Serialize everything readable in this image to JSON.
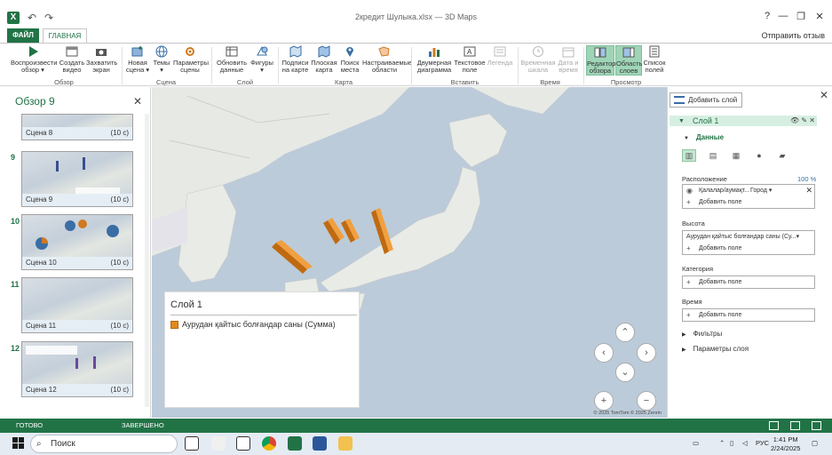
{
  "titlebar": {
    "app_icon": "X",
    "title": "2кредит Шулыка.xlsx — 3D Maps",
    "help": "?",
    "minimize": "—",
    "restore": "❐",
    "close": "✕"
  },
  "tabs": {
    "file": "ФАЙЛ",
    "home": "ГЛАВНАЯ",
    "signout": "Отправить отзыв"
  },
  "ribbon": {
    "buttons": [
      {
        "l1": "Воспроизвести",
        "l2": "обзор ▾"
      },
      {
        "l1": "Создать",
        "l2": "видео"
      },
      {
        "l1": "Захватить",
        "l2": "экран"
      },
      {
        "l1": "Новая",
        "l2": "сцена ▾"
      },
      {
        "l1": "Темы",
        "l2": "▾"
      },
      {
        "l1": "Параметры",
        "l2": "сцены"
      },
      {
        "l1": "Обновить",
        "l2": "данные"
      },
      {
        "l1": "Фигуры",
        "l2": "▾"
      },
      {
        "l1": "Подписи",
        "l2": "на карте"
      },
      {
        "l1": "Плоская",
        "l2": "карта"
      },
      {
        "l1": "Поиск",
        "l2": "места"
      },
      {
        "l1": "Настраиваемые",
        "l2": "области"
      },
      {
        "l1": "Двумерная",
        "l2": "диаграмма"
      },
      {
        "l1": "Текстовое",
        "l2": "поле"
      },
      {
        "l1": "Легенда",
        "l2": ""
      },
      {
        "l1": "Временная",
        "l2": "шкала"
      },
      {
        "l1": "Дата и",
        "l2": "время"
      },
      {
        "l1": "Редактор",
        "l2": "обзора"
      },
      {
        "l1": "Область",
        "l2": "слоев"
      },
      {
        "l1": "Список",
        "l2": "полей"
      }
    ],
    "groups": [
      "Обзор",
      "Сцена",
      "Слой",
      "Карта",
      "Вставить",
      "Время",
      "Просмотр"
    ]
  },
  "scenes_panel": {
    "title": "Обзор 9",
    "close": "✕",
    "scenes": [
      {
        "num": "",
        "name": "Сцена 8",
        "duration": "(10 с)"
      },
      {
        "num": "9",
        "name": "Сцена 9",
        "duration": "(10 с)"
      },
      {
        "num": "10",
        "name": "Сцена 10",
        "duration": "(10 с)"
      },
      {
        "num": "11",
        "name": "Сцена 11",
        "duration": "(10 с)"
      },
      {
        "num": "12",
        "name": "Сцена 12",
        "duration": "(10 с)"
      }
    ]
  },
  "map": {
    "legend_title": "Слой 1",
    "legend_item": "Аурудан қайтыс болғандар саны (Сумма)",
    "legend_color": "#e08a1a",
    "copyright": "© 2025 TomTom  © 2025 Zenrin"
  },
  "layers_panel": {
    "add_layer": "Добавить слой",
    "layer_name": "Слой 1",
    "data_section": "Данные",
    "location_label": "Расположение",
    "location_percent": "100 %",
    "location_field": "Қалалар/аумақт...",
    "location_type": "Город ▾",
    "add_field": "Добавить поле",
    "height_label": "Высота",
    "height_field": "Аурудан қайтыс болғандар саны (Су...▾",
    "category_label": "Категория",
    "time_label": "Время",
    "filters": "Фильтры",
    "layer_options": "Параметры слоя"
  },
  "statusbar": {
    "ready": "ГОТОВО",
    "done": "ЗАВЕРШЕНО"
  },
  "taskbar": {
    "search_placeholder": "Поиск",
    "lang": "РУС",
    "time": "1:41 PM",
    "date": "2/24/2025"
  }
}
